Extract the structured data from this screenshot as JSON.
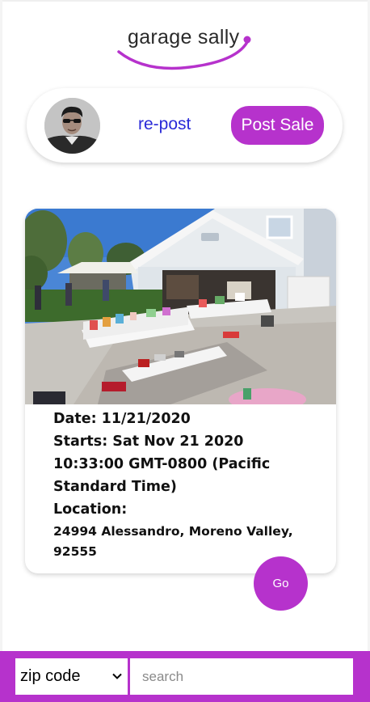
{
  "app": {
    "logo_text": "garage sally",
    "accent_color": "#b632cc"
  },
  "profile": {
    "repost_label": "re-post",
    "post_sale_label": "Post Sale"
  },
  "sale": {
    "date": "Date: 11/21/2020",
    "starts_line1": "Starts: Sat Nov 21 2020",
    "starts_line2": "10:33:00 GMT-0800 (Pacific",
    "starts_line3": "Standard Time)",
    "location_label": "Location:",
    "address_line1": "24994 Alessandro, Moreno Valley,",
    "address_line2": "92555",
    "go_label": "Go"
  },
  "search_bar": {
    "select_value": "zip code",
    "input_placeholder": "search",
    "input_value": ""
  }
}
